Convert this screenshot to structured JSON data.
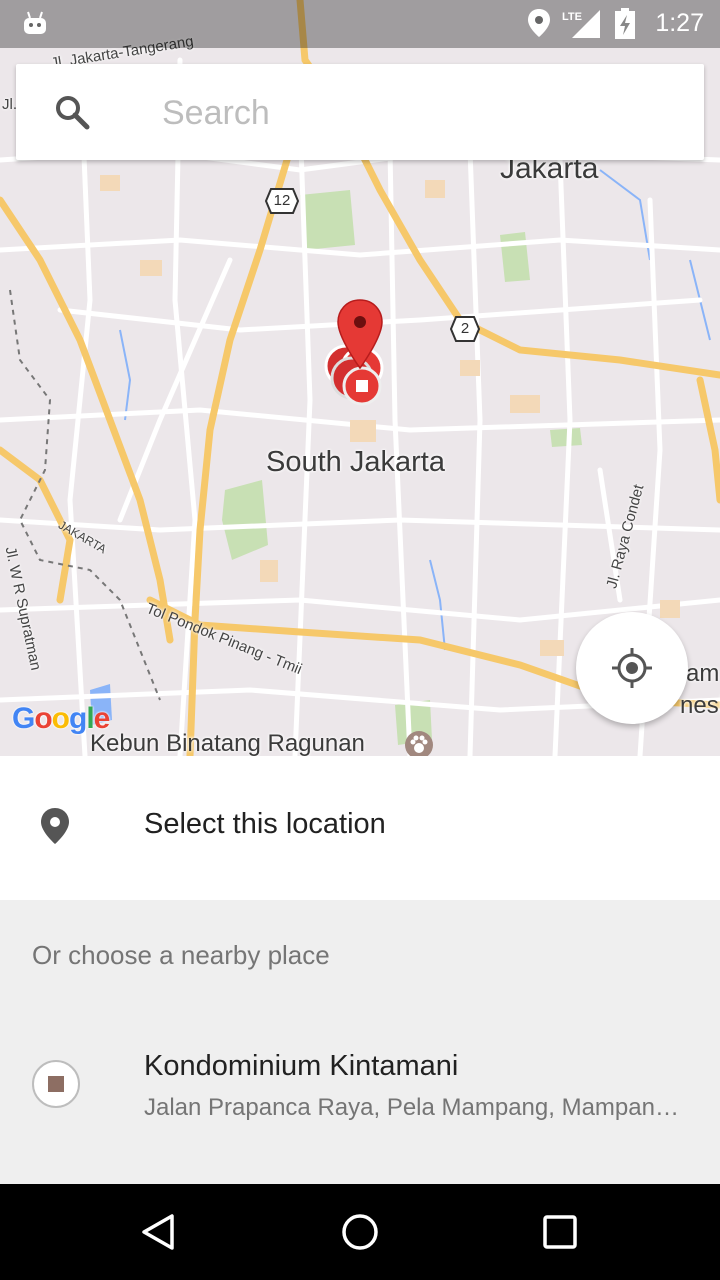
{
  "status_bar": {
    "time": "1:27",
    "network": "LTE",
    "icons": [
      "android-icon",
      "location-icon",
      "lte-signal-icon",
      "battery-charging-icon"
    ]
  },
  "search": {
    "placeholder": "Search",
    "value": ""
  },
  "map": {
    "labels": {
      "jakarta": "Jakarta",
      "south_jakarta": "South Jakarta",
      "tangerang_road": "Jl. Jakarta-Tangerang",
      "jl_left": "Jl.",
      "route_12": "12",
      "route_2": "2",
      "tol_road": "Tol Pondok Pinang - Tmii",
      "supratman": "Jl. W R Supratman",
      "jakarta_border": "JAKARTA",
      "raya_condet": "Jl. Raya Condet",
      "kebun": "Kebun Binatang Ragunan",
      "edge_am": "am",
      "edge_nesi": "nesi"
    },
    "colors": {
      "land": "#ece7ea",
      "road_major": "#f6c86a",
      "road_minor": "#ffffff",
      "park": "#c8e0b4",
      "water": "#8ab4f8",
      "marker": "#e53935"
    }
  },
  "google_logo": {
    "letters": [
      "G",
      "o",
      "o",
      "g",
      "l",
      "e"
    ],
    "colors": [
      "#4285f4",
      "#ea4335",
      "#fbbc05",
      "#4285f4",
      "#34a853",
      "#ea4335"
    ]
  },
  "select_location": {
    "label": "Select this location"
  },
  "nearby": {
    "header": "Or choose a nearby place",
    "places": [
      {
        "name": "Kondominium Kintamani",
        "address": "Jalan Prapanca Raya, Pela Mampang, Mampang Prapatan"
      }
    ]
  }
}
